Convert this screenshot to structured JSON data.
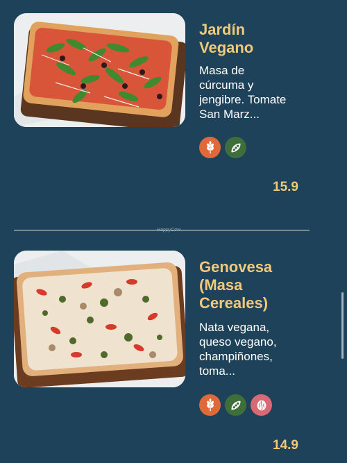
{
  "items": [
    {
      "title_lines": [
        "Jardín",
        "Vegano"
      ],
      "description_lines": [
        "Masa de",
        "cúrcuma y",
        "jengibre. Tomate",
        "San Marz..."
      ],
      "icons": [
        "wheat-icon",
        "pea-pod-icon"
      ],
      "price": "15.9"
    },
    {
      "title_lines": [
        "Genovesa",
        "(Masa",
        "Cereales)"
      ],
      "description_lines": [
        "Nata vegana,",
        "queso vegano,",
        "champiñones,",
        "toma..."
      ],
      "icons": [
        "wheat-icon",
        "pea-pod-icon",
        "nut-icon"
      ],
      "price": "14.9"
    }
  ],
  "watermark": "HappyCow",
  "colors": {
    "background": "#1d4259",
    "title": "#f2c879",
    "price": "#f2c879",
    "wheat_badge": "#e0693a",
    "pea_badge": "#3e6e3a",
    "nut_badge": "#d86a75"
  }
}
